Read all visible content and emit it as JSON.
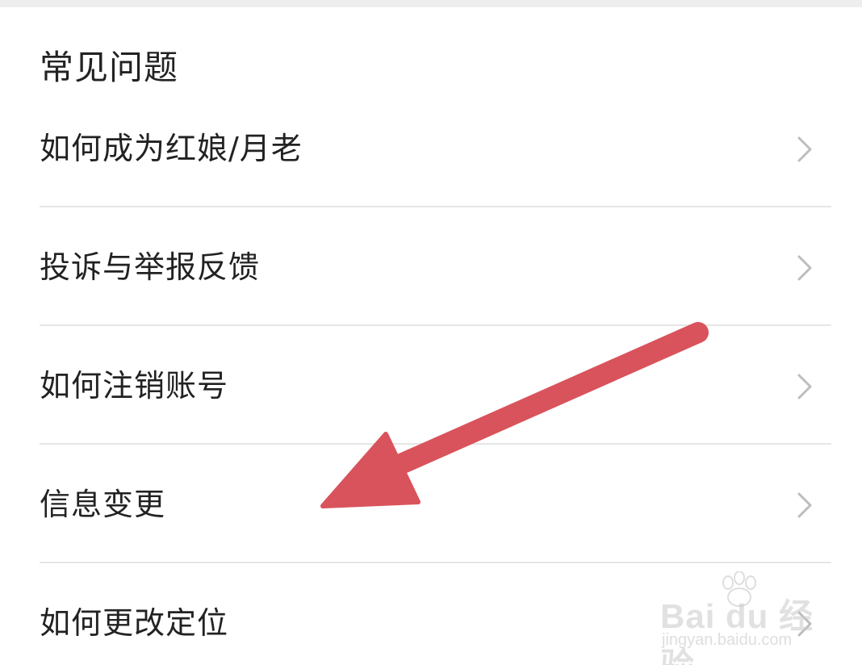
{
  "section": {
    "title": "常见问题"
  },
  "faq": {
    "items": [
      {
        "label": "如何成为红娘/月老"
      },
      {
        "label": "投诉与举报反馈"
      },
      {
        "label": "如何注销账号"
      },
      {
        "label": "信息变更"
      },
      {
        "label": "如何更改定位"
      }
    ]
  },
  "annotation": {
    "arrow_color": "#d9535c"
  },
  "watermark": {
    "logo_text": "Bai du 经验",
    "site": "jingyan.baidu.com"
  },
  "icons": {
    "chevron": "chevron-right-icon",
    "paw": "paw-icon"
  },
  "colors": {
    "text": "#222222",
    "divider": "#e6e6e6",
    "chevron": "#bdbdbd",
    "top_strip": "#eeeeee"
  }
}
